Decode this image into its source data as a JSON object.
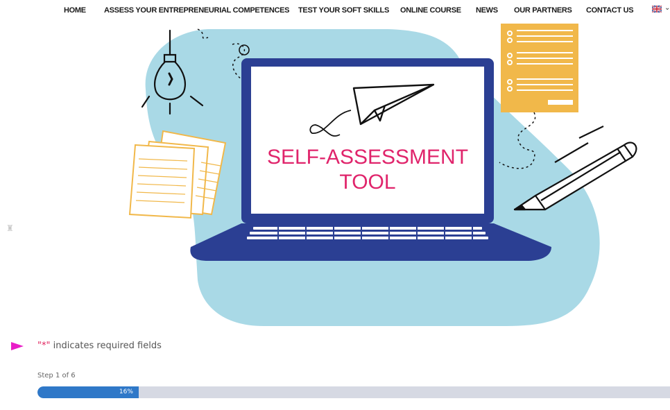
{
  "nav": {
    "items": [
      "HOME",
      "ASSESS YOUR ENTREPRENEURIAL COMPETENCES",
      "TEST YOUR SOFT SKILLS",
      "ONLINE COURSE",
      "NEWS",
      "OUR PARTNERS",
      "CONTACT US"
    ],
    "language_icon": "uk-flag-icon",
    "language_caret_icon": "chevron-down-icon"
  },
  "hero": {
    "screen_title_line1": "SELF-ASSESSMENT",
    "screen_title_line2": "TOOL",
    "colors": {
      "blob": "#a9d9e6",
      "laptop": "#2b3f93",
      "title": "#e0246b",
      "accent_yellow": "#f1b84a"
    }
  },
  "form": {
    "required_marker": "\"*\"",
    "required_text": " indicates required fields",
    "step_text": "Step 1 of 6",
    "progress_value": 0.16,
    "progress_label": "16%",
    "colors": {
      "progress_fill": "#2f78c8",
      "progress_track": "#d6d9e3",
      "arrow": "#e91ec8"
    }
  }
}
